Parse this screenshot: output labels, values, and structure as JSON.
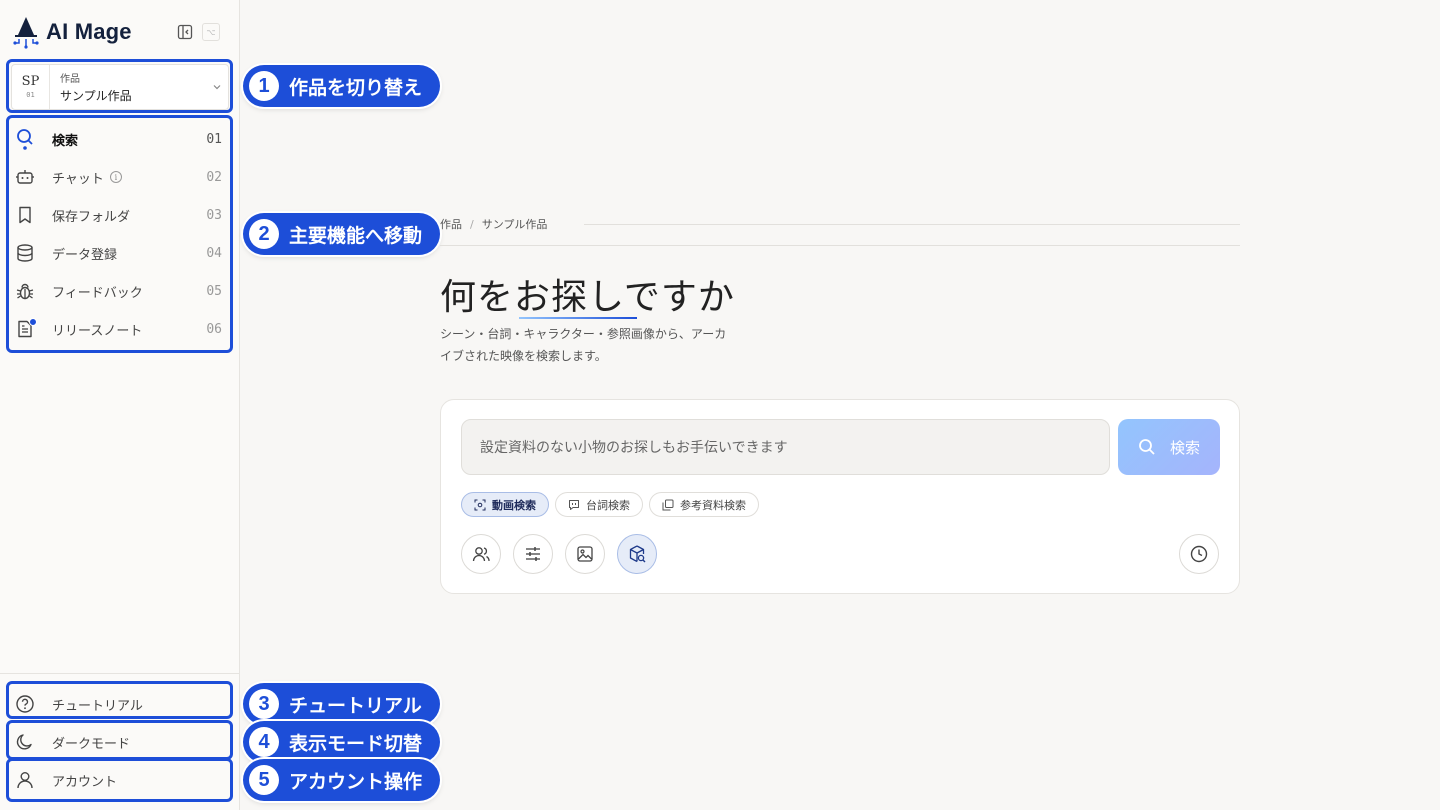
{
  "app": {
    "name": "AI Mage"
  },
  "workspace": {
    "code": "SP",
    "code_sub": "01",
    "label": "作品",
    "name": "サンプル作品"
  },
  "nav": {
    "items": [
      {
        "label": "検索",
        "num": "01",
        "icon": "search-icon",
        "active": true
      },
      {
        "label": "チャット",
        "num": "02",
        "icon": "bot-icon"
      },
      {
        "label": "保存フォルダ",
        "num": "03",
        "icon": "bookmark-icon"
      },
      {
        "label": "データ登録",
        "num": "04",
        "icon": "database-icon"
      },
      {
        "label": "フィードバック",
        "num": "05",
        "icon": "bug-icon"
      },
      {
        "label": "リリースノート",
        "num": "06",
        "icon": "notes-icon"
      }
    ]
  },
  "bottom": {
    "tutorial": "チュートリアル",
    "dark_mode": "ダークモード",
    "account": "アカウント"
  },
  "callouts": [
    {
      "num": "1",
      "text": "作品を切り替え"
    },
    {
      "num": "2",
      "text": "主要機能へ移動"
    },
    {
      "num": "3",
      "text": "チュートリアル"
    },
    {
      "num": "4",
      "text": "表示モード切替"
    },
    {
      "num": "5",
      "text": "アカウント操作"
    }
  ],
  "breadcrumb": {
    "root": "作品",
    "sep": "/",
    "current": "サンプル作品"
  },
  "main": {
    "headline": "何をお探しですか",
    "subtext": "シーン・台詞・キャラクター・参照画像から、アーカイブされた映像を検索します。"
  },
  "search": {
    "placeholder": "設定資料のない小物のお探しもお手伝いできます",
    "button": "検索",
    "tabs": [
      {
        "label": "動画検索",
        "active": true
      },
      {
        "label": "台詞検索"
      },
      {
        "label": "参考資料検索"
      }
    ],
    "tools": [
      "people-icon",
      "sliders-icon",
      "image-icon",
      "package-search-icon"
    ],
    "history_icon": "clock-icon"
  },
  "colors": {
    "accent": "#1d4ed8",
    "brand": "#14213d"
  }
}
